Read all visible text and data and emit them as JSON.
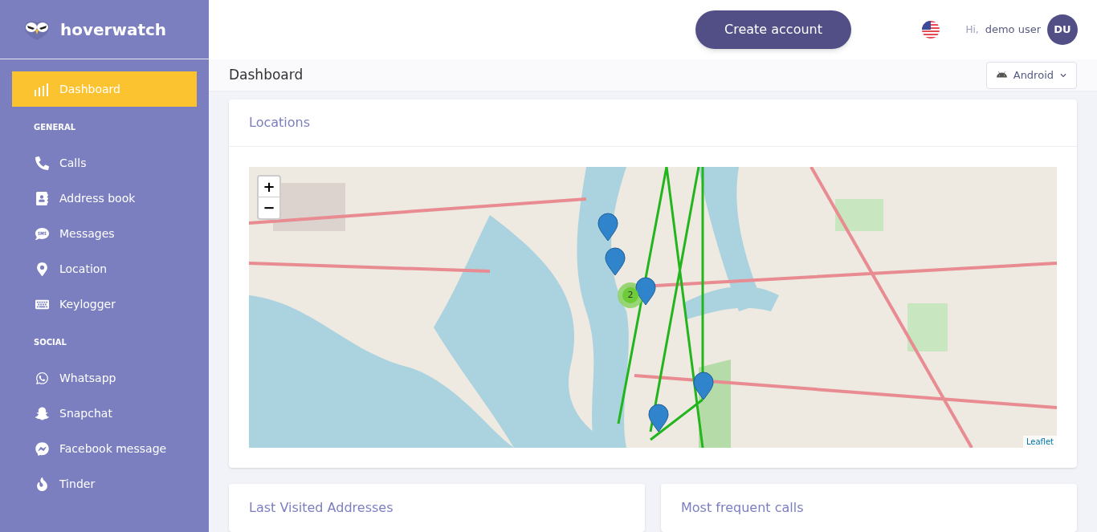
{
  "brand": {
    "name": "hoverwatch"
  },
  "sidebar": {
    "top_item": {
      "label": "Dashboard",
      "selected": true
    },
    "sections": [
      {
        "title": "GENERAL",
        "items": [
          {
            "label": "Calls",
            "selected": false
          },
          {
            "label": "Address book",
            "selected": false
          },
          {
            "label": "Messages",
            "selected": false
          },
          {
            "label": "Location",
            "selected": false
          },
          {
            "label": "Keylogger",
            "selected": false
          }
        ]
      },
      {
        "title": "SOCIAL",
        "items": [
          {
            "label": "Whatsapp",
            "selected": false
          },
          {
            "label": "Snapchat",
            "selected": false
          },
          {
            "label": "Facebook message",
            "selected": false
          },
          {
            "label": "Tinder",
            "selected": false
          }
        ]
      }
    ]
  },
  "header": {
    "cta": "Create account",
    "greeting": "Hi,",
    "user": "demo user",
    "avatar": "DU"
  },
  "page": {
    "title": "Dashboard",
    "device": "Android"
  },
  "locations": {
    "title": "Locations",
    "map": {
      "kind": "picture",
      "zoom_in": "+",
      "zoom_out": "−",
      "cluster": "2",
      "attribution": "Leaflet"
    }
  },
  "cards": [
    {
      "title": "Last Visited Addresses"
    },
    {
      "title": "Most frequent calls"
    }
  ]
}
